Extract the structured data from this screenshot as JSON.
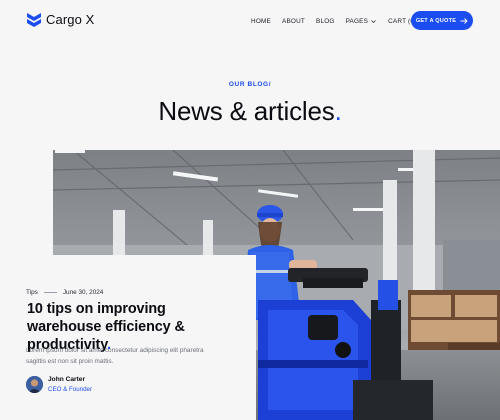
{
  "brand": {
    "name": "Cargo X",
    "logo_icon": "chevron-stack-logo",
    "accent": "#1b4df0"
  },
  "nav": {
    "items": [
      {
        "label": "HOME"
      },
      {
        "label": "ABOUT"
      },
      {
        "label": "BLOG"
      },
      {
        "label": "PAGES"
      },
      {
        "label": "CART (0)"
      }
    ],
    "cta_label": "GET A QUOTE"
  },
  "section": {
    "eyebrow": "OUR BLOG/",
    "heading": "News & articles",
    "heading_dot": "."
  },
  "featured_post": {
    "image": "warehouse-worker-forklift-photo",
    "category": "Tips",
    "date": "June 30, 2024",
    "title": "10 tips on improving warehouse efficiency & productivity",
    "title_dot": ".",
    "excerpt": "Lorem ipsum dolor sit amet consectetur adipiscing elit pharetra sagittis est non sit proin mattis.",
    "author": {
      "name": "John Carter",
      "role": "CEO & Founder"
    }
  }
}
